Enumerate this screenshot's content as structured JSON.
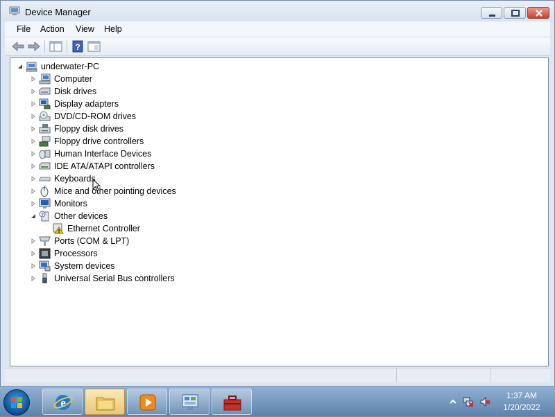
{
  "window": {
    "title": "Device Manager"
  },
  "menu": [
    "File",
    "Action",
    "View",
    "Help"
  ],
  "tree": {
    "root": "underwater-PC",
    "nodes": [
      {
        "label": "Computer",
        "icon": "computer-icon",
        "expanded": false
      },
      {
        "label": "Disk drives",
        "icon": "disk-drive-icon",
        "expanded": false
      },
      {
        "label": "Display adapters",
        "icon": "display-adapter-icon",
        "expanded": false
      },
      {
        "label": "DVD/CD-ROM drives",
        "icon": "dvd-drive-icon",
        "expanded": false
      },
      {
        "label": "Floppy disk drives",
        "icon": "floppy-drive-icon",
        "expanded": false
      },
      {
        "label": "Floppy drive controllers",
        "icon": "floppy-controller-icon",
        "expanded": false
      },
      {
        "label": "Human Interface Devices",
        "icon": "hid-icon",
        "expanded": false
      },
      {
        "label": "IDE ATA/ATAPI controllers",
        "icon": "ide-controller-icon",
        "expanded": false
      },
      {
        "label": "Keyboards",
        "icon": "keyboard-icon",
        "expanded": false
      },
      {
        "label": "Mice and other pointing devices",
        "icon": "mouse-icon",
        "expanded": false
      },
      {
        "label": "Monitors",
        "icon": "monitor-icon",
        "expanded": false
      },
      {
        "label": "Other devices",
        "icon": "unknown-device-icon",
        "expanded": true,
        "children": [
          {
            "label": "Ethernet Controller",
            "icon": "warning-device-icon"
          }
        ]
      },
      {
        "label": "Ports (COM & LPT)",
        "icon": "port-icon",
        "expanded": false
      },
      {
        "label": "Processors",
        "icon": "processor-icon",
        "expanded": false
      },
      {
        "label": "System devices",
        "icon": "system-device-icon",
        "expanded": false
      },
      {
        "label": "Universal Serial Bus controllers",
        "icon": "usb-icon",
        "expanded": false
      }
    ]
  },
  "taskbar": {
    "items": [
      "internet-explorer-icon",
      "file-explorer-icon",
      "media-player-icon",
      "control-panel-icon",
      "toolbox-icon"
    ],
    "clock": {
      "time": "1:37 AM",
      "date": "1/20/2022"
    }
  },
  "colors": {
    "warning": "#f5c400",
    "selection": "#cde8ff"
  }
}
